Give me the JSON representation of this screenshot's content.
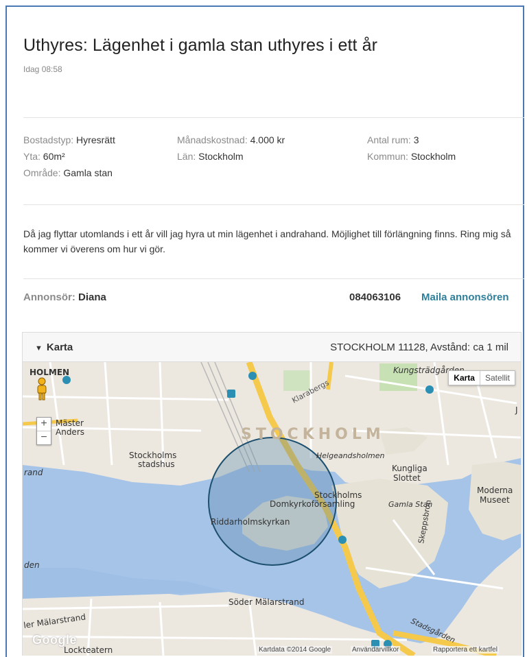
{
  "listing": {
    "title": "Uthyres: Lägenhet i gamla stan uthyres i ett år",
    "timestamp": "Idag 08:58"
  },
  "details": {
    "bostadstyp": {
      "label": "Bostadstyp:",
      "value": "Hyresrätt"
    },
    "yta": {
      "label": "Yta:",
      "value": "60m²"
    },
    "omrade": {
      "label": "Område:",
      "value": "Gamla stan"
    },
    "manadskostnad": {
      "label": "Månadskostnad:",
      "value": "4.000 kr"
    },
    "lan": {
      "label": "Län:",
      "value": "Stockholm"
    },
    "antal_rum": {
      "label": "Antal rum:",
      "value": "3"
    },
    "kommun": {
      "label": "Kommun:",
      "value": "Stockholm"
    }
  },
  "description": "Då jag flyttar utomlands i ett år vill jag hyra ut min lägenhet i andrahand. Möjlighet till förlängning finns. Ring mig så kommer vi överens om hur vi gör.",
  "advertiser": {
    "label": "Annonsör:",
    "name": "Diana",
    "phone": "084063106",
    "mail_label": "Maila annonsören"
  },
  "map": {
    "toggle_label": "Karta",
    "location": "STOCKHOLM 11128, Avstånd: ca 1 mil",
    "type_map": "Karta",
    "type_satellite": "Satellit",
    "zoom_in": "+",
    "zoom_out": "−",
    "google_logo": "Google",
    "footer_data": "Kartdata ©2014 Google",
    "footer_terms": "Användarvillkor",
    "footer_report": "Rapportera ett kartfel",
    "labels": {
      "holmen": "HOLMEN",
      "master_anders": "Mäster",
      "master_anders2": "Anders",
      "stockholm": "STOCKHOLM",
      "klara": "Klarabergs",
      "kungstradgarden": "Kungsträdgården",
      "stadshus1": "Stockholms",
      "stadshus2": "stadshus",
      "helgeandsholmen": "Helgeandsholmen",
      "kungliga1": "Kungliga",
      "kungliga2": "Slottet",
      "stockholms_dom1": "Stockholms",
      "stockholms_dom2": "Domkyrkoförsamling",
      "gamla_stan": "Gamla Stan",
      "moderna1": "Moderna",
      "moderna2": "Museet",
      "riddarholm": "Riddarholmskyrkan",
      "skeppsbron": "Skeppsbron",
      "soder_malarstrand": "Söder Mälarstrand",
      "norr_malarstrand": "ler Mälarstrand",
      "den": "den",
      "rand": "rand",
      "stadsgarden": "Stadsgården",
      "lockteatern": "Lockteatern",
      "j": "J"
    },
    "colors": {
      "water": "#a6c4e8",
      "land": "#ece8e0",
      "road_major": "#f5c94b",
      "radius_circle": "#1c4f6e"
    }
  }
}
